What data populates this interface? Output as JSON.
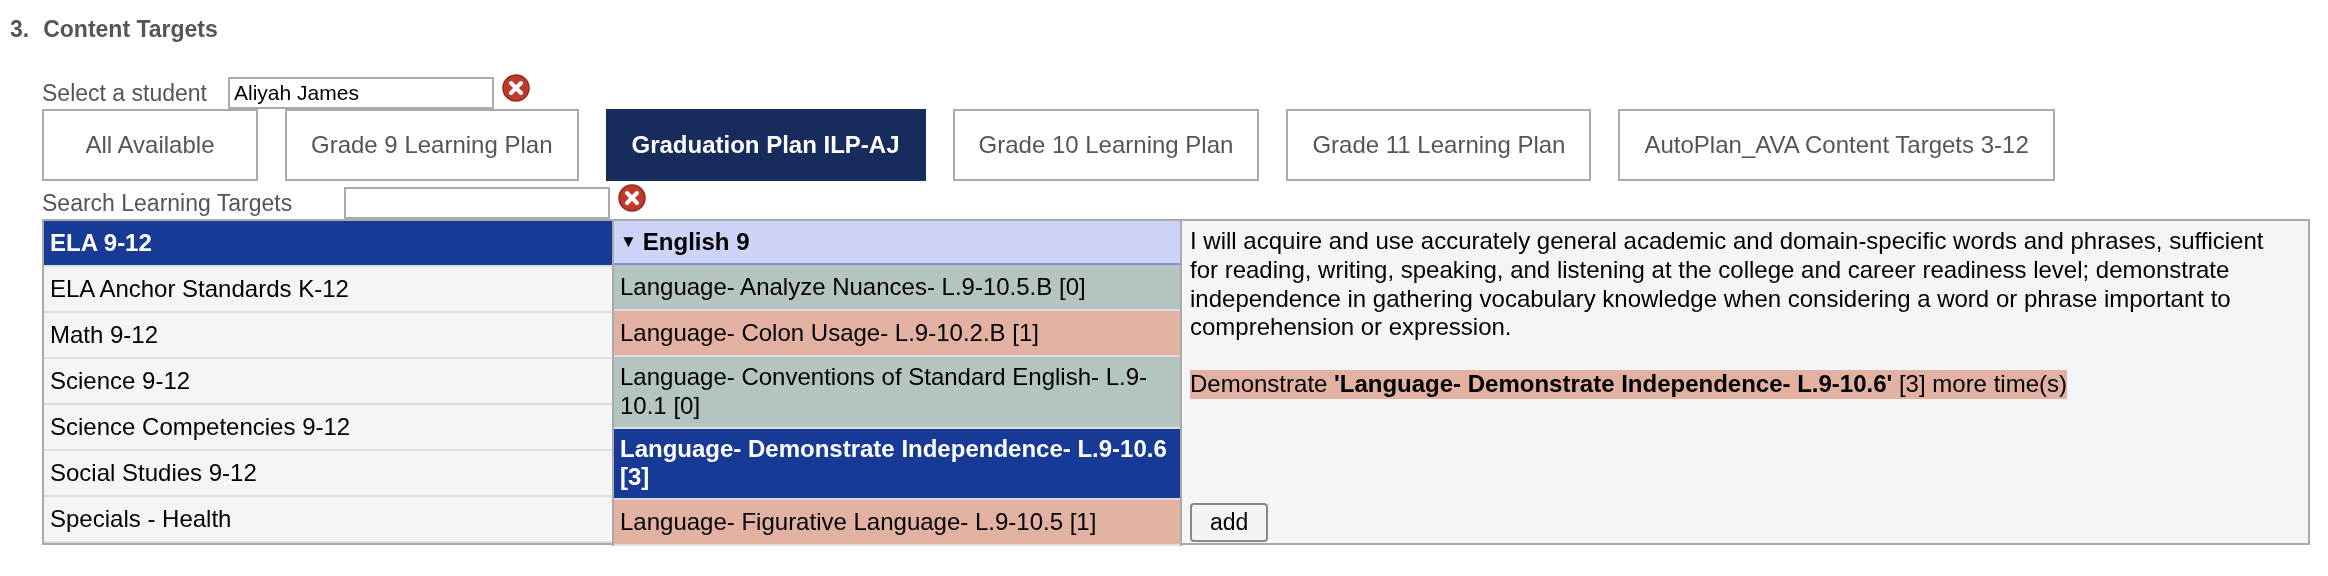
{
  "section": {
    "number": "3.",
    "title": "Content Targets"
  },
  "student_field": {
    "label": "Select a student",
    "value": "Aliyah James"
  },
  "tabs": [
    {
      "label": "All Available",
      "selected": false
    },
    {
      "label": "Grade 9 Learning Plan",
      "selected": false
    },
    {
      "label": "Graduation Plan ILP-AJ",
      "selected": true
    },
    {
      "label": "Grade 10 Learning Plan",
      "selected": false
    },
    {
      "label": "Grade 11 Learning Plan",
      "selected": false
    },
    {
      "label": "AutoPlan_AVA Content Targets 3-12",
      "selected": false
    }
  ],
  "search_field": {
    "label": "Search Learning Targets"
  },
  "subjects": [
    {
      "label": "ELA 9-12",
      "selected": true
    },
    {
      "label": "ELA Anchor Standards K-12",
      "selected": false
    },
    {
      "label": "Math 9-12",
      "selected": false
    },
    {
      "label": "Science 9-12",
      "selected": false
    },
    {
      "label": "Science Competencies 9-12",
      "selected": false
    },
    {
      "label": "Social Studies 9-12",
      "selected": false
    },
    {
      "label": "Specials - Health",
      "selected": false
    }
  ],
  "target_group": {
    "arrow": "▼",
    "title": "English 9",
    "expanded": true
  },
  "targets": [
    {
      "label": "Language- Analyze Nuances- L.9-10.5.B [0]",
      "color": "#b3c4c2",
      "selected": false
    },
    {
      "label": "Language- Colon Usage- L.9-10.2.B [1]",
      "color": "#e2b1a1",
      "selected": false
    },
    {
      "label": "Language- Conventions of Standard English- L.9-10.1 [0]",
      "color": "#b3c4c2",
      "selected": false
    },
    {
      "label": "Language- Demonstrate Independence- L.9-10.6 [3]",
      "selected": true
    },
    {
      "label": "Language- Figurative Language- L.9-10.5 [1]",
      "color": "#e2b1a1",
      "selected": false
    }
  ],
  "detail": {
    "description": "I will acquire and use accurately general academic and domain-specific words and phrases, sufficient for reading, writing, speaking, and listening at the college and career readiness level; demonstrate independence in gathering vocabulary knowledge when considering a word or phrase important to comprehension or expression.",
    "requirement": "Demonstrate **'Language- Demonstrate Independence- L.9-10.6'** [3] more time(s)",
    "button": "add"
  }
}
